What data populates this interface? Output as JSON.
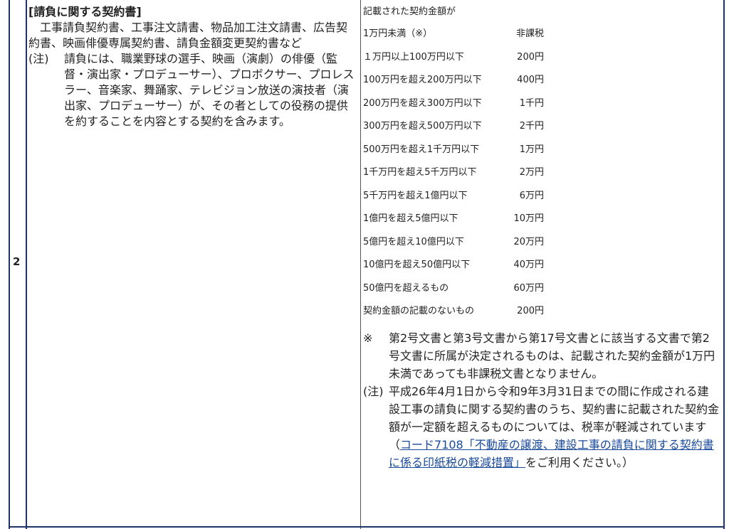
{
  "row_number": "2",
  "left": {
    "title": "[請負に関する契約書]",
    "description": "工事請負契約書、工事注文請書、物品加工注文請書、広告契約書、映画俳優専属契約書、請負金額変更契約書など",
    "note_mark": "(注)",
    "note_text": "請負には、職業野球の選手、映画（演劇）の俳優（監督・演出家・プロデューサー）、プロボクサー、プロレスラー、音楽家、舞踊家、テレビジョン放送の演技者（演出家、プロデューサー）が、その者としての役務の提供を約することを内容とする契約を含みます。"
  },
  "right": {
    "header": "記載された契約金額が",
    "rates": [
      {
        "range": "1万円未満（※）",
        "tax": "非課税"
      },
      {
        "range": "１万円以上100万円以下",
        "tax": "200円"
      },
      {
        "range": "100万円を超え200万円以下",
        "tax": "400円"
      },
      {
        "range": "200万円を超え300万円以下",
        "tax": "1千円"
      },
      {
        "range": "300万円を超え500万円以下",
        "tax": "2千円"
      },
      {
        "range": "500万円を超え1千万円以下",
        "tax": "1万円"
      },
      {
        "range": "1千万円を超え5千万円以下",
        "tax": "2万円"
      },
      {
        "range": "5千万円を超え1億円以下",
        "tax": "6万円"
      },
      {
        "range": "1億円を超え5億円以下",
        "tax": "10万円"
      },
      {
        "range": "5億円を超え10億円以下",
        "tax": "20万円"
      },
      {
        "range": "10億円を超え50億円以下",
        "tax": "40万円"
      },
      {
        "range": "50億円を超えるもの",
        "tax": "60万円"
      },
      {
        "range": "契約金額の記載のないもの",
        "tax": "200円"
      }
    ],
    "note1_mark": "※",
    "note1_text": "第2号文書と第3号文書から第17号文書とに該当する文書で第2号文書に所属が決定されるものは、記載された契約金額が1万円未満であっても非課税文書となりません。",
    "note2_mark": "(注)",
    "note2_text_before": "平成26年4月1日から令和9年3月31日までの間に作成される建設工事の請負に関する契約書のうち、契約書に記載された契約金額が一定額を超えるものについては、税率が軽減されています（",
    "note2_link": "コード7108「不動産の譲渡、建設工事の請負に関する契約書に係る印紙税の軽減措置」",
    "note2_text_after": "をご利用ください。）"
  }
}
